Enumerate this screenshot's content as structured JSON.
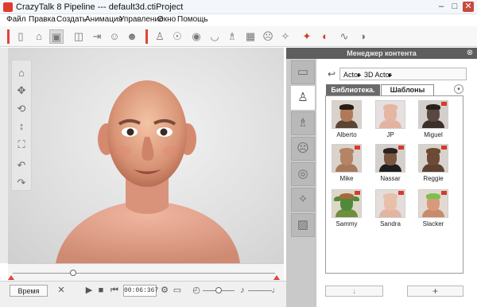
{
  "window": {
    "title": "CrazyTalk 8 Pipeline --- default3d.ctiProject",
    "controls": {
      "minimize": "–",
      "maximize": "□",
      "close": "✕"
    }
  },
  "menu": [
    "Файл",
    "Правка",
    "Создать",
    "Анимация",
    "Управление",
    "Окно",
    "Помощь"
  ],
  "toolbar": {
    "icons": [
      "new-file-icon",
      "open-folder-icon",
      "save-icon",
      "preview-icon",
      "export-icon",
      "face-setup-icon",
      "face-fitting-icon",
      "actor-icon",
      "morph-icon",
      "eye-icon",
      "mouth-icon",
      "body-icon",
      "checker-icon",
      "head-icon",
      "wand-icon",
      "puppet-icon",
      "face-key-icon",
      "audio-icon",
      "talk-icon"
    ]
  },
  "viewport": {
    "side_tools": [
      "home-icon",
      "move-icon",
      "rotate-icon",
      "zoom-icon",
      "fit-icon",
      "undo-icon",
      "redo-icon"
    ]
  },
  "timeline": {
    "position": 0.23
  },
  "playback": {
    "time_button": "Время",
    "timecode": "00:06:367"
  },
  "content_manager": {
    "title": "Менеджер контента",
    "breadcrumb": [
      "Actor",
      "3D Actor"
    ],
    "tabs": {
      "library": "Библиотека.",
      "templates": "Шаблоны"
    },
    "selected_tab": "templates",
    "side_tabs": [
      "folder-icon",
      "actor-icon",
      "body-icon",
      "face-icon",
      "audio-icon",
      "scene-icon",
      "image-icon"
    ],
    "items": [
      {
        "name": "Alberto",
        "skin": "#b07a5a",
        "bg": "#d9d2cb",
        "hair": "#2b1d15",
        "shirt": "#5a4536",
        "badge": false
      },
      {
        "name": "JP",
        "skin": "#e5b6a2",
        "bg": "#e6e0e0",
        "hair": "#e5b6a2",
        "shirt": "#e2b3a0",
        "badge": false
      },
      {
        "name": "Miguel",
        "skin": "#5a4840",
        "bg": "#d4cfcb",
        "hair": "#2a201b",
        "shirt": "#3b302c",
        "badge": true
      },
      {
        "name": "Mike",
        "skin": "#b58464",
        "bg": "#dad3cc",
        "hair": "#b58464",
        "shirt": "#a77859",
        "badge": true
      },
      {
        "name": "Nassar",
        "skin": "#7a563f",
        "bg": "#d5cfcb",
        "hair": "#2b2220",
        "shirt": "#1e1e1e",
        "badge": true
      },
      {
        "name": "Reggie",
        "skin": "#6c4a36",
        "bg": "#d8d2cc",
        "hair": "#6c4a36",
        "shirt": "#5e4130",
        "badge": true
      },
      {
        "name": "Sammy",
        "skin": "#4f8a3a",
        "bg": "#ded7c8",
        "hair": "#a7693b",
        "shirt": "#6e8f3a",
        "badge": true,
        "ears": true
      },
      {
        "name": "Sandra",
        "skin": "#e8bfa9",
        "bg": "#e4ddda",
        "hair": "#e8bfa9",
        "shirt": "#e2b5a0",
        "badge": true
      },
      {
        "name": "Slacker",
        "skin": "#d89a7a",
        "bg": "#e2d9d2",
        "hair": "#7cc04a",
        "shirt": "#c98a6a",
        "badge": true
      }
    ],
    "buttons": {
      "import": "↓",
      "add": "+"
    }
  },
  "colors": {
    "accent": "#e0443a",
    "panel_header": "#5e5e5e",
    "tab_active": "#6a6a6a"
  }
}
